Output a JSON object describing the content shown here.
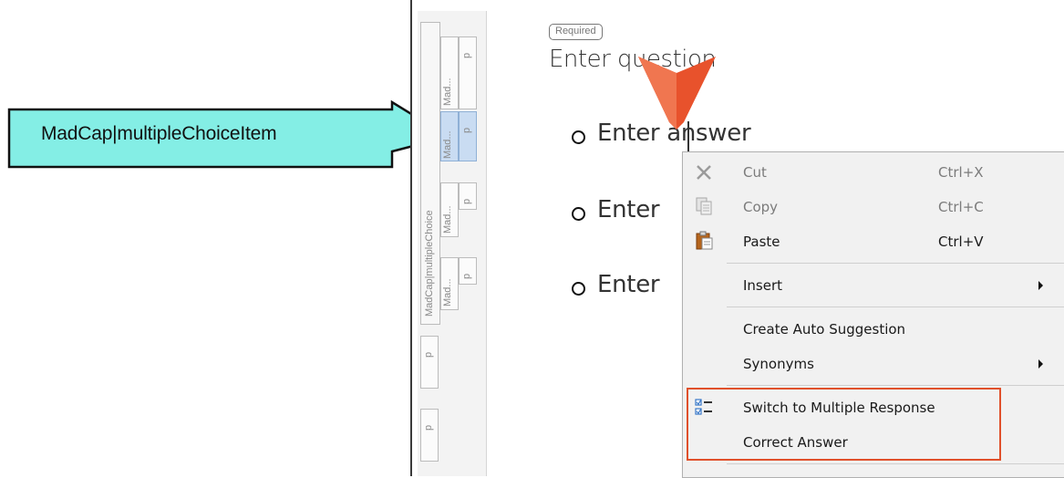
{
  "callout": {
    "text": "MadCap|multipleChoiceItem",
    "fill_color": "#84eee5",
    "border_color": "#111111"
  },
  "structure_bar": {
    "outer_label": "MadCap|multipleChoice",
    "rows": [
      {
        "tag_label": "Mad...",
        "p_label": "p"
      },
      {
        "tag_label": "Mad...",
        "p_label": "p",
        "selected": true
      },
      {
        "tag_label": "Mad...",
        "p_label": "p"
      },
      {
        "tag_label": "Mad...",
        "p_label": "p"
      }
    ],
    "extra_p": [
      "p",
      "p"
    ]
  },
  "question": {
    "required_label": "Required",
    "placeholder": "Enter question"
  },
  "answers": [
    {
      "text": "Enter answer"
    },
    {
      "text": "Enter"
    },
    {
      "text": "Enter"
    }
  ],
  "pointer": {
    "icon": "arrow-pointer-icon",
    "color": "#e8522c"
  },
  "context_menu": {
    "items": [
      {
        "label": "Cut",
        "shortcut": "Ctrl+X",
        "icon": "cut-icon",
        "disabled": true
      },
      {
        "label": "Copy",
        "shortcut": "Ctrl+C",
        "icon": "copy-icon",
        "disabled": true
      },
      {
        "label": "Paste",
        "shortcut": "Ctrl+V",
        "icon": "paste-icon",
        "disabled": false
      },
      {
        "label": "Insert",
        "submenu": true
      },
      {
        "label": "Create Auto Suggestion"
      },
      {
        "label": "Synonyms",
        "submenu": true
      },
      {
        "label": "Switch to Multiple Response",
        "icon": "multiple-response-icon"
      },
      {
        "label": "Correct Answer"
      }
    ],
    "highlight_color": "#e0502b"
  }
}
